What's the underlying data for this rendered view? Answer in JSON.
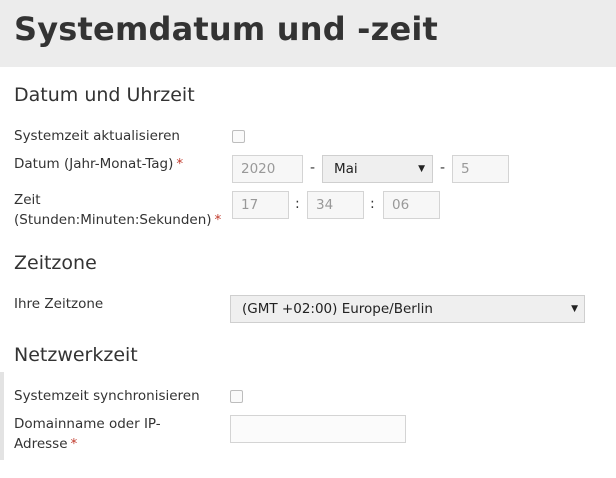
{
  "page": {
    "title": "Systemdatum und -zeit"
  },
  "datetime": {
    "section_title": "Datum und Uhrzeit",
    "update_label": "Systemzeit aktualisieren",
    "date_label": "Datum (Jahr-Monat-Tag)",
    "year": "2020",
    "month": "Mai",
    "day": "5",
    "date_separator": "-",
    "time_label_line1": "Zeit",
    "time_label_line2": "(Stunden:Minuten:Sekunden)",
    "hour": "17",
    "minute": "34",
    "second": "06",
    "time_separator": ":"
  },
  "timezone": {
    "section_title": "Zeitzone",
    "label": "Ihre Zeitzone",
    "value": "(GMT +02:00) Europe/Berlin"
  },
  "ntp": {
    "section_title": "Netzwerkzeit",
    "sync_label": "Systemzeit synchronisieren",
    "server_label_line1": "Domainname oder IP-",
    "server_label_line2": "Adresse",
    "server_value": ""
  },
  "required_marker": "*",
  "icons": {
    "dropdown": "triangle-down"
  },
  "colors": {
    "required": "#c0392b",
    "header_bg": "#ececec"
  }
}
